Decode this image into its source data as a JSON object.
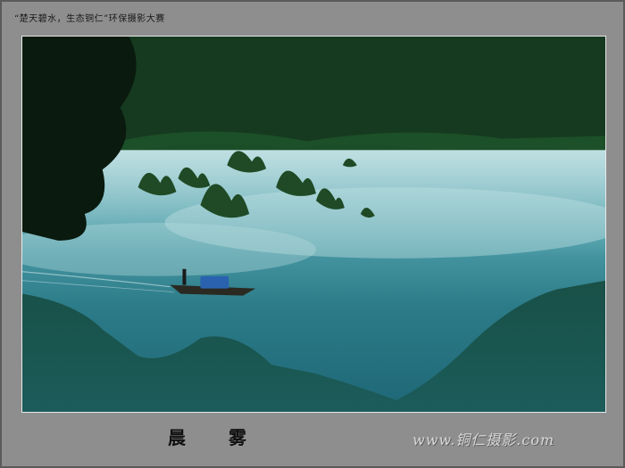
{
  "header": {
    "contest_caption": "“楚天碧水，生态铜仁”环保摄影大赛"
  },
  "photo": {
    "scene": "misty-river-boat"
  },
  "caption": {
    "title": "晨雾"
  },
  "watermark": {
    "text": "www.铜仁摄影.com"
  },
  "colors": {
    "frame": "#8e8e8e",
    "water": "#2a6a78",
    "forest": "#0f2a17"
  }
}
